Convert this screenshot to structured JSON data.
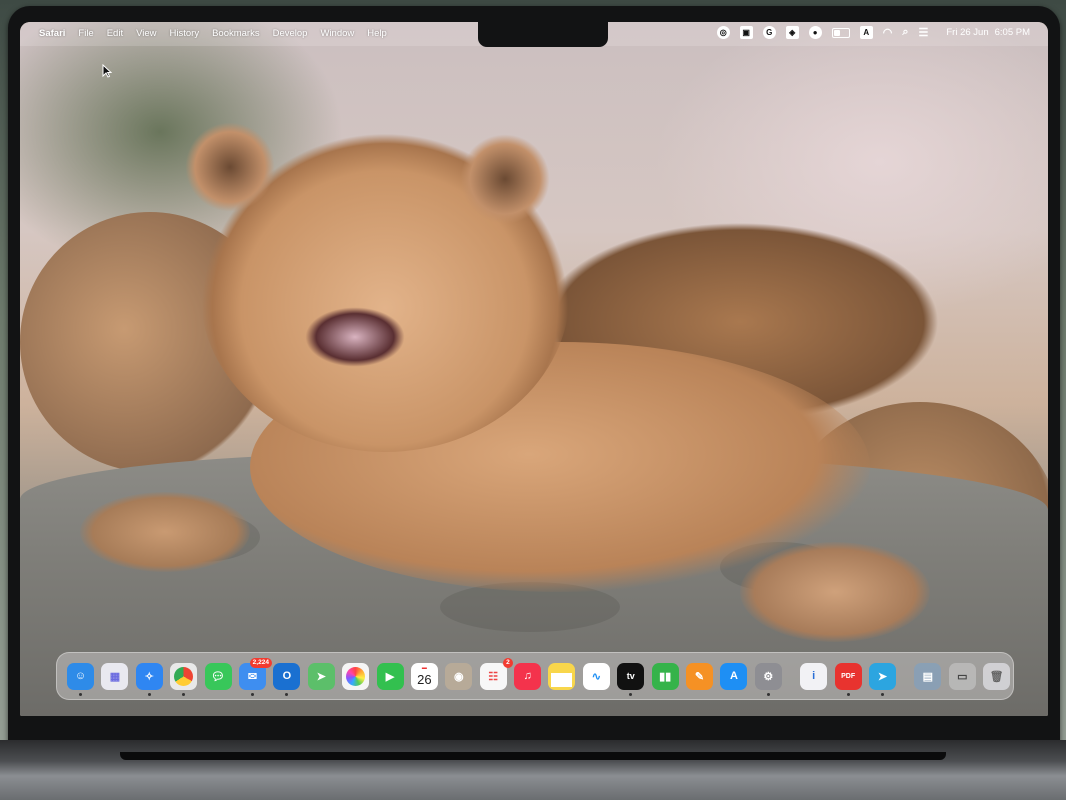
{
  "menubar": {
    "app_name": "Safari",
    "menus": [
      "File",
      "Edit",
      "View",
      "History",
      "Bookmarks",
      "Develop",
      "Window",
      "Help"
    ],
    "status_icons": [
      "chatgpt-icon",
      "screen-recorder-icon",
      "grammarly-icon",
      "cube-icon",
      "user-icon",
      "battery-icon",
      "input-source-icon",
      "wifi-icon",
      "search-icon",
      "control-center-icon"
    ],
    "input_source_label": "A",
    "date": "Fri 26 Jun",
    "time": "6:05 PM"
  },
  "wallpaper": {
    "subject": "lion cub"
  },
  "dock": {
    "apps": [
      {
        "name": "Finder",
        "icon": "finder-icon",
        "color": "#2e8be8"
      },
      {
        "name": "Launchpad",
        "icon": "launchpad-icon",
        "color": "#e9e9f0"
      },
      {
        "name": "Safari",
        "icon": "safari-icon",
        "color": "#2f86f2"
      },
      {
        "name": "Chrome",
        "icon": "chrome-icon",
        "color": "#e9e9e9"
      },
      {
        "name": "Messages",
        "icon": "messages-icon",
        "color": "#38c75a"
      },
      {
        "name": "Mail",
        "icon": "mail-icon",
        "color": "#3e8ef0",
        "badge": "2,224"
      },
      {
        "name": "Outlook",
        "icon": "outlook-icon",
        "color": "#1a70d1"
      },
      {
        "name": "Maps",
        "icon": "maps-icon",
        "color": "#5cbf6a"
      },
      {
        "name": "Photos",
        "icon": "photos-icon",
        "color": "#f5f5f5"
      },
      {
        "name": "FaceTime",
        "icon": "facetime-icon",
        "color": "#33c04f"
      },
      {
        "name": "Calendar",
        "icon": "calendar-icon",
        "color": "#ffffff",
        "day": "26"
      },
      {
        "name": "Contacts",
        "icon": "contacts-icon",
        "color": "#b7aa98"
      },
      {
        "name": "Reminders",
        "icon": "reminders-icon",
        "color": "#f7f7f7",
        "badge": "2"
      },
      {
        "name": "Music",
        "icon": "music-icon",
        "color": "#f4334c"
      },
      {
        "name": "Notes",
        "icon": "notes-icon",
        "color": "#f8d64b"
      },
      {
        "name": "Freeform",
        "icon": "freeform-icon",
        "color": "#ffffff"
      },
      {
        "name": "TV",
        "icon": "tv-icon",
        "color": "#111111",
        "label": "tv"
      },
      {
        "name": "Numbers",
        "icon": "numbers-icon",
        "color": "#35b34a"
      },
      {
        "name": "Pages",
        "icon": "pages-icon",
        "color": "#f59124"
      },
      {
        "name": "App Store",
        "icon": "app-store-icon",
        "color": "#1e8ff4"
      },
      {
        "name": "System Settings",
        "icon": "settings-icon",
        "color": "#8e8e93"
      }
    ],
    "recent_apps": [
      {
        "name": "System Information",
        "icon": "info-icon",
        "color": "#f2f2f5"
      },
      {
        "name": "PDF Expert",
        "icon": "pdf-icon",
        "color": "#e8332f",
        "label": "PDF"
      },
      {
        "name": "Telegram",
        "icon": "telegram-icon",
        "color": "#2ca5e0"
      }
    ],
    "stacks": [
      {
        "name": "Applications",
        "icon": "folder-stack-icon"
      },
      {
        "name": "Downloads",
        "icon": "downloads-stack-icon"
      },
      {
        "name": "Trash",
        "icon": "trash-icon"
      }
    ]
  }
}
